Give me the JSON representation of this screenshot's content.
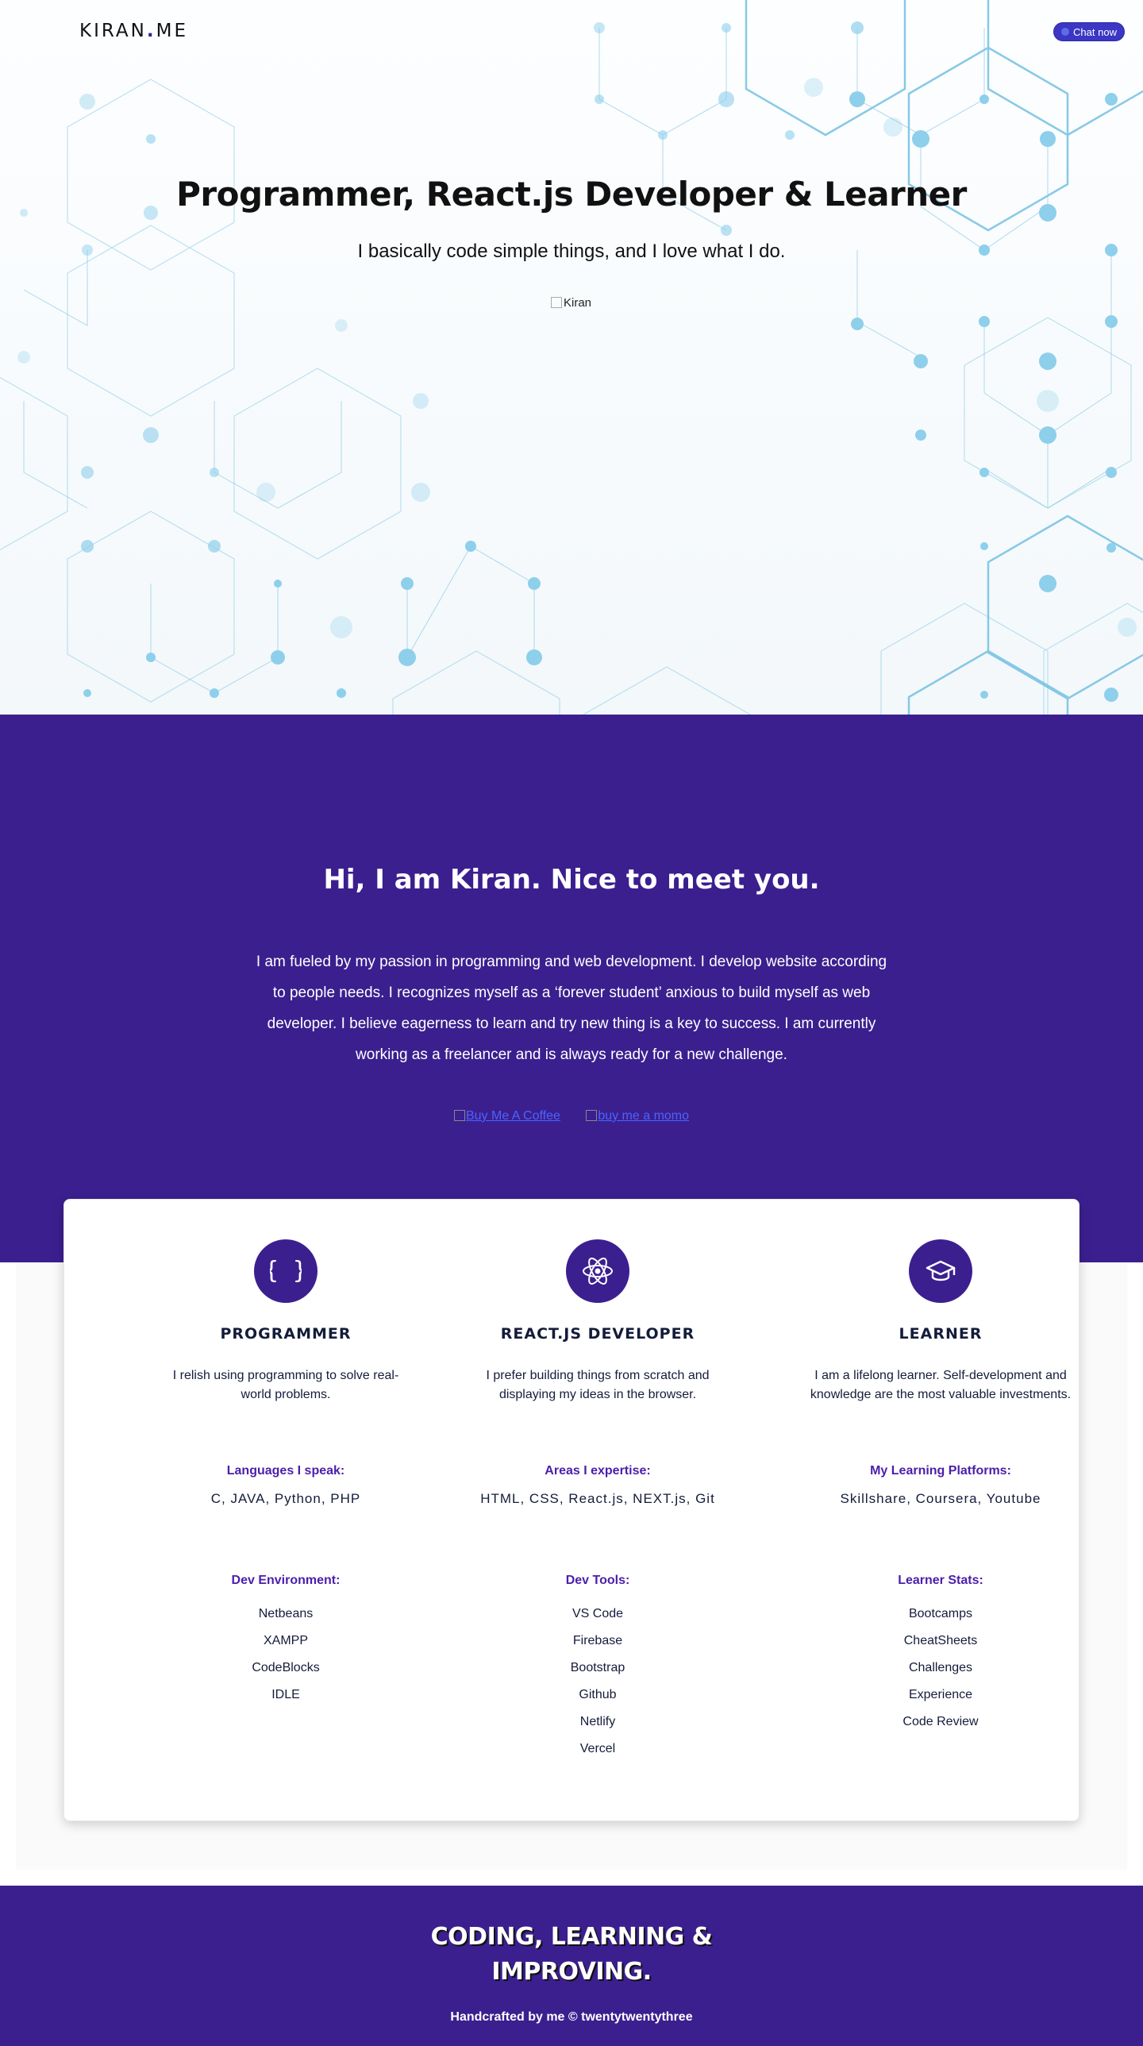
{
  "header": {
    "logo_left": "KIRAN",
    "logo_dot": ".",
    "logo_right": "ME",
    "chat_label": "Chat now"
  },
  "hero": {
    "title": "Programmer, React.js Developer & Learner",
    "tagline": "I basically code simple things, and I love what I do.",
    "image_alt": "Kiran"
  },
  "about": {
    "heading": "Hi, I am Kiran. Nice to meet you.",
    "bio": "I am fueled by my passion in programming and web development. I develop website according to people needs. I recognizes myself as a ‘forever student’ anxious to build myself as web developer. I believe eagerness to learn and try new thing is a key to success. I am currently working as a freelancer and is always ready for a new challenge.",
    "badge1_alt": "Buy Me A Coffee",
    "badge2_alt": "buy me a momo"
  },
  "skills": [
    {
      "icon": "braces-icon",
      "title": "PROGRAMMER",
      "desc": "I relish using programming to solve real-world problems.",
      "sub1_label": "Languages I speak:",
      "sub1_value": "C, JAVA, Python, PHP",
      "sub2_label": "Dev Environment:",
      "items": [
        "Netbeans",
        "XAMPP",
        "CodeBlocks",
        "IDLE"
      ]
    },
    {
      "icon": "atom-icon",
      "title": "REACT.JS DEVELOPER",
      "desc": "I prefer building things from scratch and displaying my ideas in the browser.",
      "sub1_label": "Areas I expertise:",
      "sub1_value": "HTML, CSS, React.js, NEXT.js, Git",
      "sub2_label": "Dev Tools:",
      "items": [
        "VS Code",
        "Firebase",
        "Bootstrap",
        "Github",
        "Netlify",
        "Vercel"
      ]
    },
    {
      "icon": "graduation-cap-icon",
      "title": "LEARNER",
      "desc": "I am a lifelong learner. Self-development and knowledge are the most valuable investments.",
      "sub1_label": "My Learning Platforms:",
      "sub1_value": "Skillshare, Coursera, Youtube",
      "sub2_label": "Learner Stats:",
      "items": [
        "Bootcamps",
        "CheatSheets",
        "Challenges",
        "Experience",
        "Code Review"
      ]
    }
  ],
  "footer": {
    "slogan_line1": "CODING, LEARNING &",
    "slogan_line2": "IMPROVING.",
    "copyright": "Handcrafted by me © twentytwentythree"
  },
  "colors": {
    "primary": "#3b1f8f",
    "accent": "#4b1eab",
    "chat": "#3b36c4",
    "hexagon": "#7ec8e3"
  }
}
